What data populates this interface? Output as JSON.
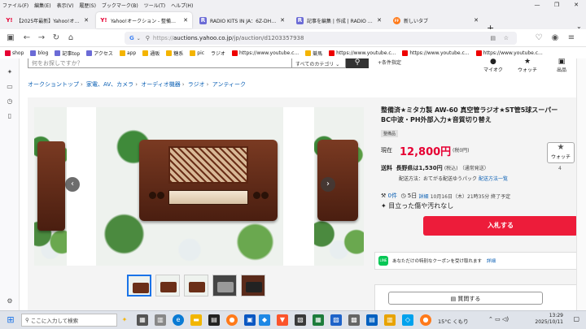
{
  "menu": [
    "ファイル(F)",
    "編集(E)",
    "表示(V)",
    "履歴(S)",
    "ブックマーク(B)",
    "ツール(T)",
    "ヘルプ(H)"
  ],
  "tabs": [
    {
      "label": "【2025年最新】Yahoo!オークション",
      "active": false,
      "favicon": "Y!"
    },
    {
      "label": "Yahoo!オークション - 整備済 ミタカ",
      "active": true,
      "favicon": "Y!"
    },
    {
      "label": "RADIO KITS IN JA：6Z-DH3A(",
      "active": false,
      "favicon": "R"
    },
    {
      "label": "記事を編集 | 作成 | RADIO KITS",
      "active": false,
      "favicon": "R"
    },
    {
      "label": "新しいタブ",
      "active": false,
      "favicon": "FF"
    }
  ],
  "url": {
    "domain": "auctions.yahoo.co.jp",
    "path": "/jp/auction/d1203357938",
    "prefix": "https://"
  },
  "bookmarks": [
    "shop",
    "blog",
    "記事top",
    "アクセス",
    "app",
    "通販",
    "糖系",
    "pic",
    "ラジオ",
    "https://www.youtube.c...",
    "競馬",
    "https://www.youtube.c...",
    "https://www.youtube.c...",
    "https://www.youtube.c..."
  ],
  "search": {
    "placeholder": "何をお探しですか？",
    "category": "すべてのカテゴリ",
    "condition": "+条件指定"
  },
  "header_icons": [
    {
      "label": "マイオク"
    },
    {
      "label": "ウォッチ"
    },
    {
      "label": "出品"
    }
  ],
  "breadcrumb": [
    "オークショントップ",
    "家電、AV、カメラ",
    "オーディオ機器",
    "ラジオ",
    "アンティーク"
  ],
  "product": {
    "title": "整備済★ミタカ製 AW-60 真空管ラジオ★ST管5球スーパー　BC中波・PH外部入力★音質切り替え",
    "badge": "整備品",
    "price_label": "現在",
    "price": "12,800円",
    "tax": "(税0円)",
    "watch_label": "ウォッチ",
    "watch_count": "4",
    "ship_label": "送料",
    "ship_text": "長野県は1,530円",
    "ship_tax": "(税込)",
    "ship_sub": "（通常発送）",
    "ship_method": "配送方法：おてがる配送ゆうパック",
    "ship_link": "配送方法一覧",
    "bids": "0件",
    "remaining": "5日",
    "detail_link": "詳細",
    "end_time": "10月16日（木）21時35分 終了予定",
    "condition": "目立った傷や汚れなし",
    "bid_button": "入札する",
    "coupon_text": "あなただけの特別なクーポンを受け取れます",
    "coupon_link": "詳細",
    "line_label": "LINE",
    "question_button": "質問する"
  },
  "taskbar": {
    "search_placeholder": "ここに入力して検索",
    "weather": "15°C くもり",
    "time": "13:29",
    "date": "2025/10/11"
  },
  "colors": {
    "price": "#e60033",
    "bid_button": "#ed1c3a",
    "link": "#0a5fb4"
  }
}
